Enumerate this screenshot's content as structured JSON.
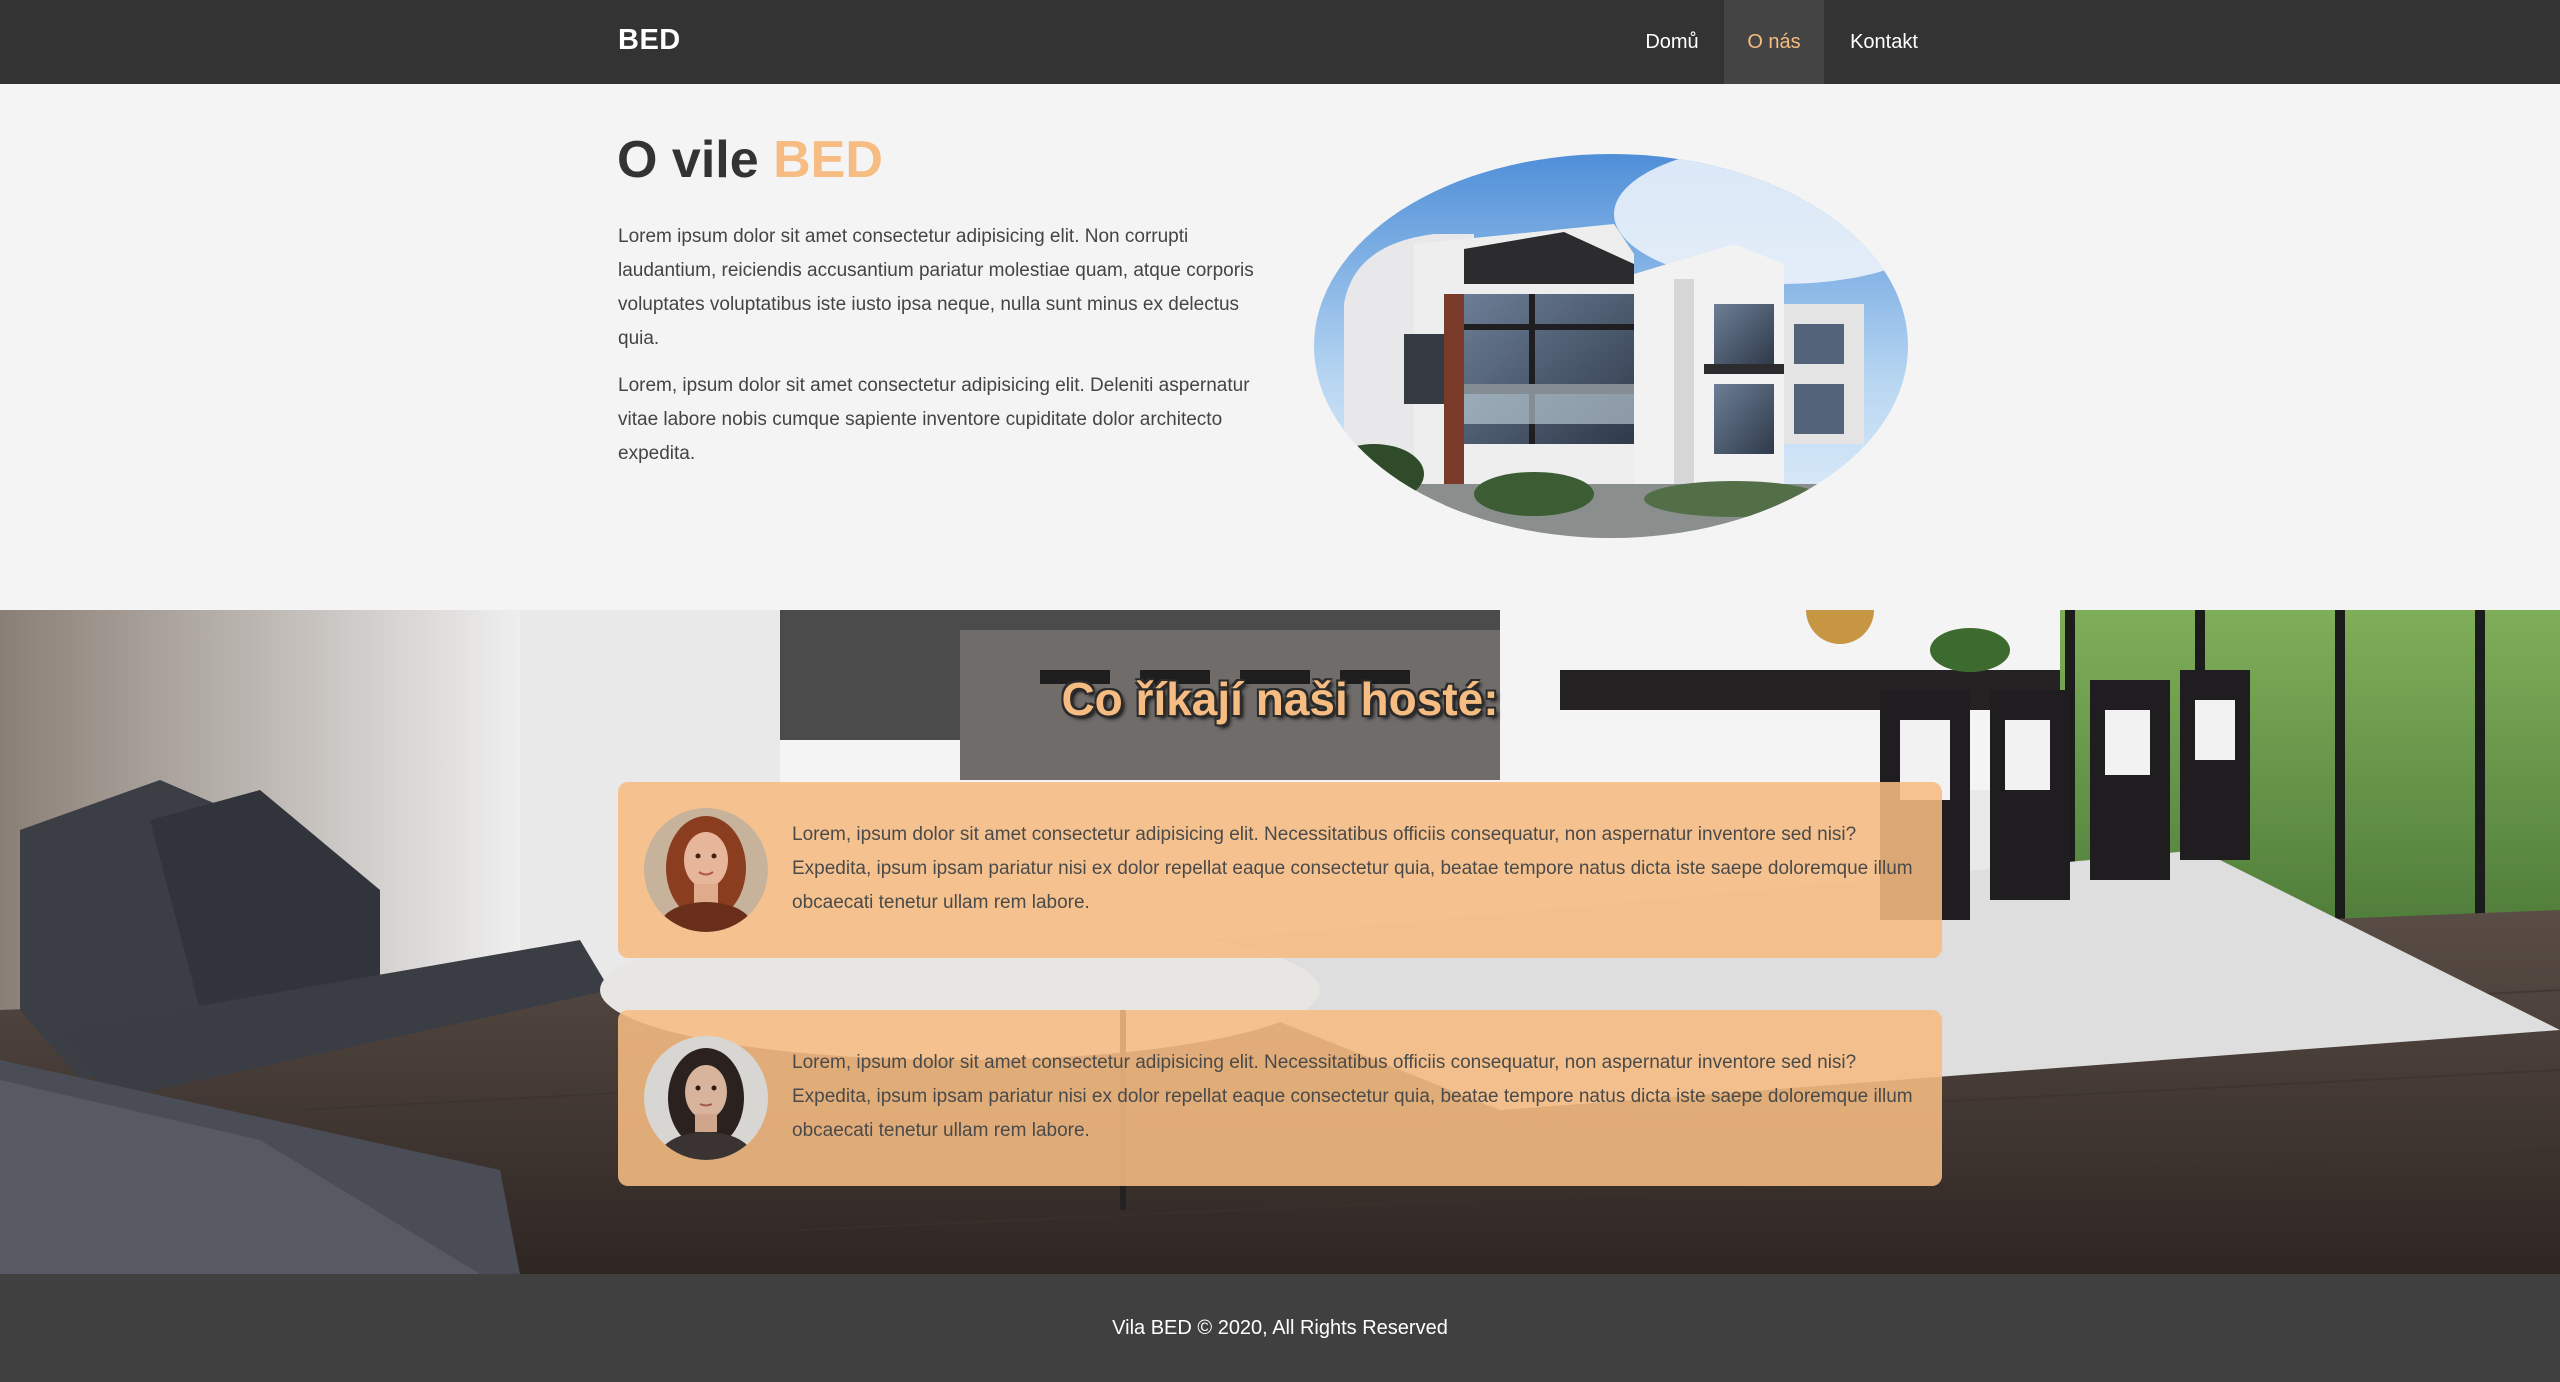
{
  "nav": {
    "brand": "BED",
    "links": [
      {
        "label": "Domů",
        "active": false
      },
      {
        "label": "O nás",
        "active": true
      },
      {
        "label": "Kontakt",
        "active": false
      }
    ]
  },
  "about": {
    "title_prefix": "O vile",
    "title_accent": "BED",
    "paragraphs": [
      "Lorem ipsum dolor sit amet consectetur adipisicing elit. Non corrupti laudantium, reiciendis accusantium pariatur molestiae quam, atque corporis voluptates voluptatibus iste iusto ipsa neque, nulla sunt minus ex delectus quia.",
      "Lorem, ipsum dolor sit amet consectetur adipisicing elit. Deleniti aspernatur vitae labore nobis cumque sapiente inventore cupiditate dolor architecto expedita."
    ]
  },
  "testimonials": {
    "heading": "Co říkají naši hosté:",
    "items": [
      {
        "text": "Lorem, ipsum dolor sit amet consectetur adipisicing elit. Necessitatibus officiis consequatur, non aspernatur inventore sed nisi? Expedita, ipsum ipsam pariatur nisi ex dolor repellat eaque consectetur quia, beatae tempore natus dicta iste saepe doloremque illum obcaecati tenetur ullam rem labore."
      },
      {
        "text": "Lorem, ipsum dolor sit amet consectetur adipisicing elit. Necessitatibus officiis consequatur, non aspernatur inventore sed nisi? Expedita, ipsum ipsam pariatur nisi ex dolor repellat eaque consectetur quia, beatae tempore natus dicta iste saepe doloremque illum obcaecati tenetur ullam rem labore."
      }
    ]
  },
  "footer": {
    "text": "Vila BED © 2020, All Rights Reserved"
  },
  "colors": {
    "accent": "#f6bc82",
    "navbar": "#333333",
    "footer": "#404040",
    "background": "#f4f4f4"
  }
}
